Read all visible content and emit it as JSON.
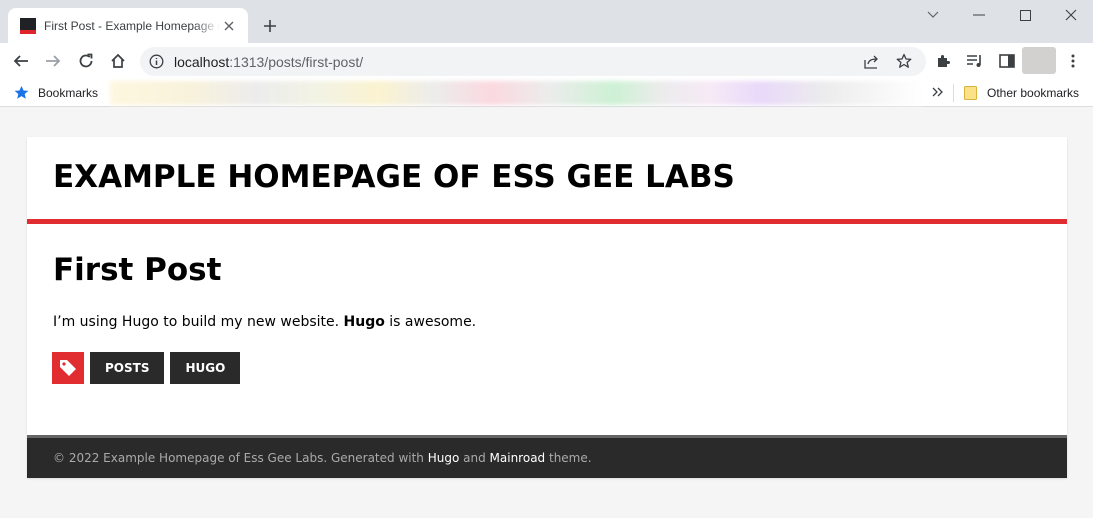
{
  "browser": {
    "tab_title": "First Post - Example Homepage of Ess Gee Labs",
    "url_host": "localhost",
    "url_path": ":1313/posts/first-post/",
    "bookmarks_label": "Bookmarks",
    "other_bookmarks_label": "Other bookmarks"
  },
  "site": {
    "title": "EXAMPLE HOMEPAGE OF ESS GEE LABS",
    "accent_color": "#e22d30"
  },
  "post": {
    "title": "First Post",
    "body_before": "I’m using Hugo to build my new website. ",
    "body_bold": "Hugo",
    "body_after": " is awesome.",
    "tags": [
      "POSTS",
      "HUGO"
    ]
  },
  "footer": {
    "prefix": "© 2022 Example Homepage of Ess Gee Labs. Generated with ",
    "link1": "Hugo",
    "middle": " and ",
    "link2": "Mainroad",
    "suffix": " theme."
  }
}
